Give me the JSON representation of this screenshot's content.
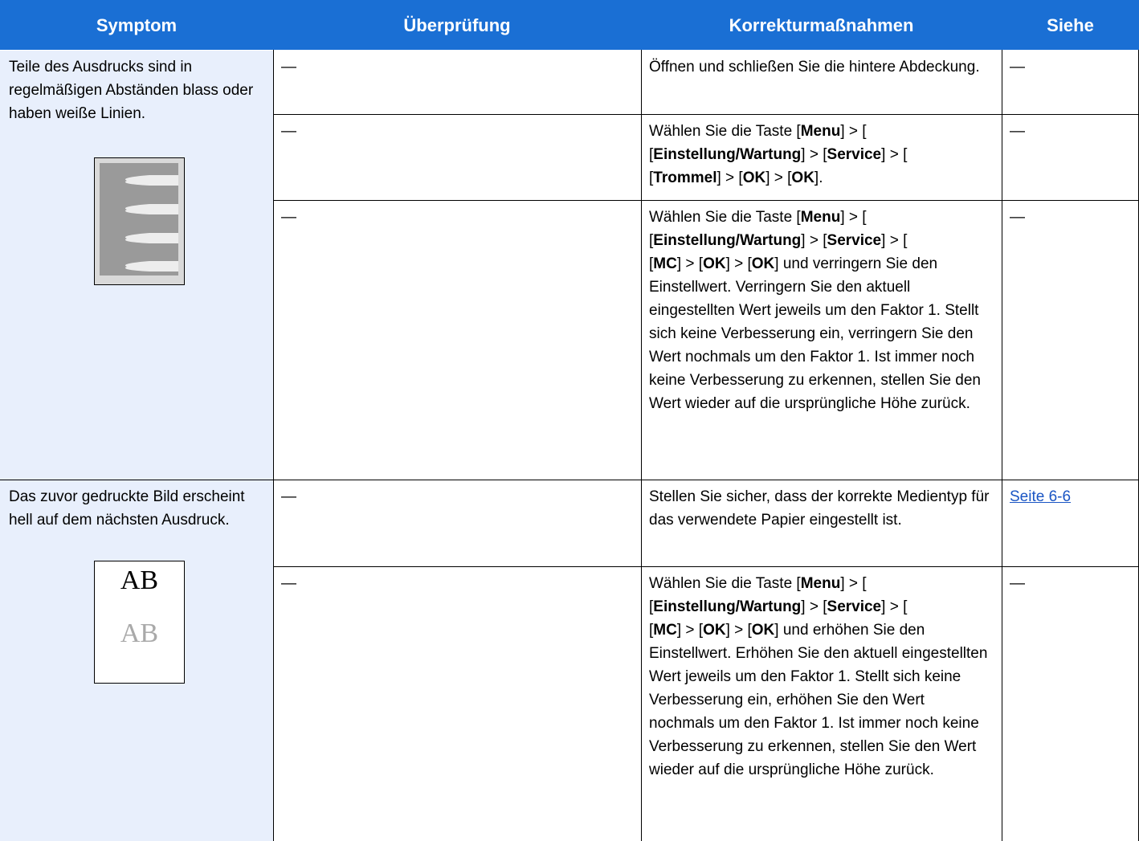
{
  "headers": {
    "symptom": "Symptom",
    "check": "Überprüfung",
    "action": "Korrekturmaßnahmen",
    "see": "Siehe"
  },
  "dash": "—",
  "row1": {
    "symptom": "Teile des Ausdrucks sind in regelmäßigen Abständen blass oder haben weiße Linien.",
    "image_icon": "faded-lines-sample-icon",
    "actions": [
      {
        "check": "—",
        "see": "—",
        "text": "Öffnen und schließen Sie die hintere Abdeckung."
      },
      {
        "check": "—",
        "see": "—",
        "p1": "Wählen Sie die Taste [",
        "b1": "Menu",
        "p2": "] > [",
        "b2": "Einstellung/Wartung",
        "p3": "] > [",
        "b3": "Service",
        "p4": "] > [",
        "b4": "Trommel",
        "p5": "] > [",
        "b5": "OK",
        "p6": "] > [",
        "b6": "OK",
        "p7": "]."
      },
      {
        "check": "—",
        "see": "—",
        "p1": "Wählen Sie die Taste [",
        "b1": "Menu",
        "p2": "] > [",
        "b2": "Einstellung/Wartung",
        "p3": "] > [",
        "b3": "Service",
        "p4": "] > [",
        "b4": "MC",
        "p5": "] > [",
        "b5": "OK",
        "p6": "] > [",
        "b6": "OK",
        "p7": "] und verringern Sie den Einstellwert. Verringern Sie den aktuell eingestellten Wert jeweils um den Faktor 1. Stellt sich keine Verbesserung ein, verringern Sie den Wert nochmals um den Faktor 1. Ist immer noch keine Verbesserung zu erkennen, stellen Sie den Wert wieder auf die ursprüngliche Höhe zurück."
      }
    ]
  },
  "row2": {
    "symptom": "Das zuvor gedruckte Bild erscheint hell auf dem nächsten Ausdruck.",
    "image_icon": "ghost-image-sample-icon",
    "ab_dark": "AB",
    "ab_light": "AB",
    "actions": [
      {
        "check": "—",
        "see": "Seite 6-6",
        "text": "Stellen Sie sicher, dass der korrekte Medientyp für das verwendete Papier eingestellt ist."
      },
      {
        "check": "—",
        "see": "—",
        "p1": "Wählen Sie die Taste [",
        "b1": "Menu",
        "p2": "] > [",
        "b2": "Einstellung/Wartung",
        "p3": "] > [",
        "b3": "Service",
        "p4": "] > [",
        "b4": "MC",
        "p5": "] > [",
        "b5": "OK",
        "p6": "] > [",
        "b6": "OK",
        "p7": "] und erhöhen Sie den Einstellwert. Erhöhen Sie den aktuell eingestellten Wert jeweils um den Faktor 1. Stellt sich keine Verbesserung ein, erhöhen Sie den Wert nochmals um den Faktor 1. Ist immer noch keine Verbesserung zu erkennen, stellen Sie den Wert wieder auf die ursprüngliche Höhe zurück."
      }
    ]
  }
}
